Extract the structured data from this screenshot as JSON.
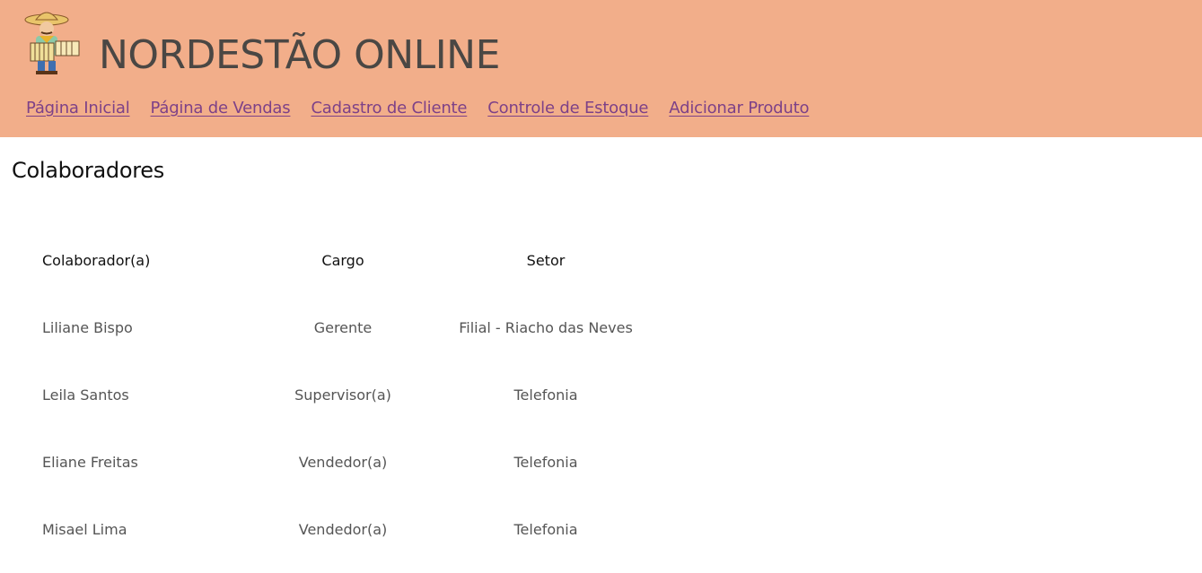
{
  "header": {
    "title": "NORDESTÃO ONLINE",
    "logo_icon": "accordion-player-icon",
    "background_color": "#f2ae8a",
    "nav": [
      {
        "label": "Página Inicial"
      },
      {
        "label": "Página de Vendas"
      },
      {
        "label": "Cadastro de Cliente"
      },
      {
        "label": "Controle de Estoque"
      },
      {
        "label": "Adicionar Produto"
      }
    ]
  },
  "main": {
    "title": "Colaboradores",
    "table": {
      "headers": [
        "Colaborador(a)",
        "Cargo",
        "Setor"
      ],
      "rows": [
        [
          "Liliane Bispo",
          "Gerente",
          "Filial - Riacho das Neves"
        ],
        [
          "Leila Santos",
          "Supervisor(a)",
          "Telefonia"
        ],
        [
          "Eliane Freitas",
          "Vendedor(a)",
          "Telefonia"
        ],
        [
          "Misael Lima",
          "Vendedor(a)",
          "Telefonia"
        ]
      ]
    }
  }
}
